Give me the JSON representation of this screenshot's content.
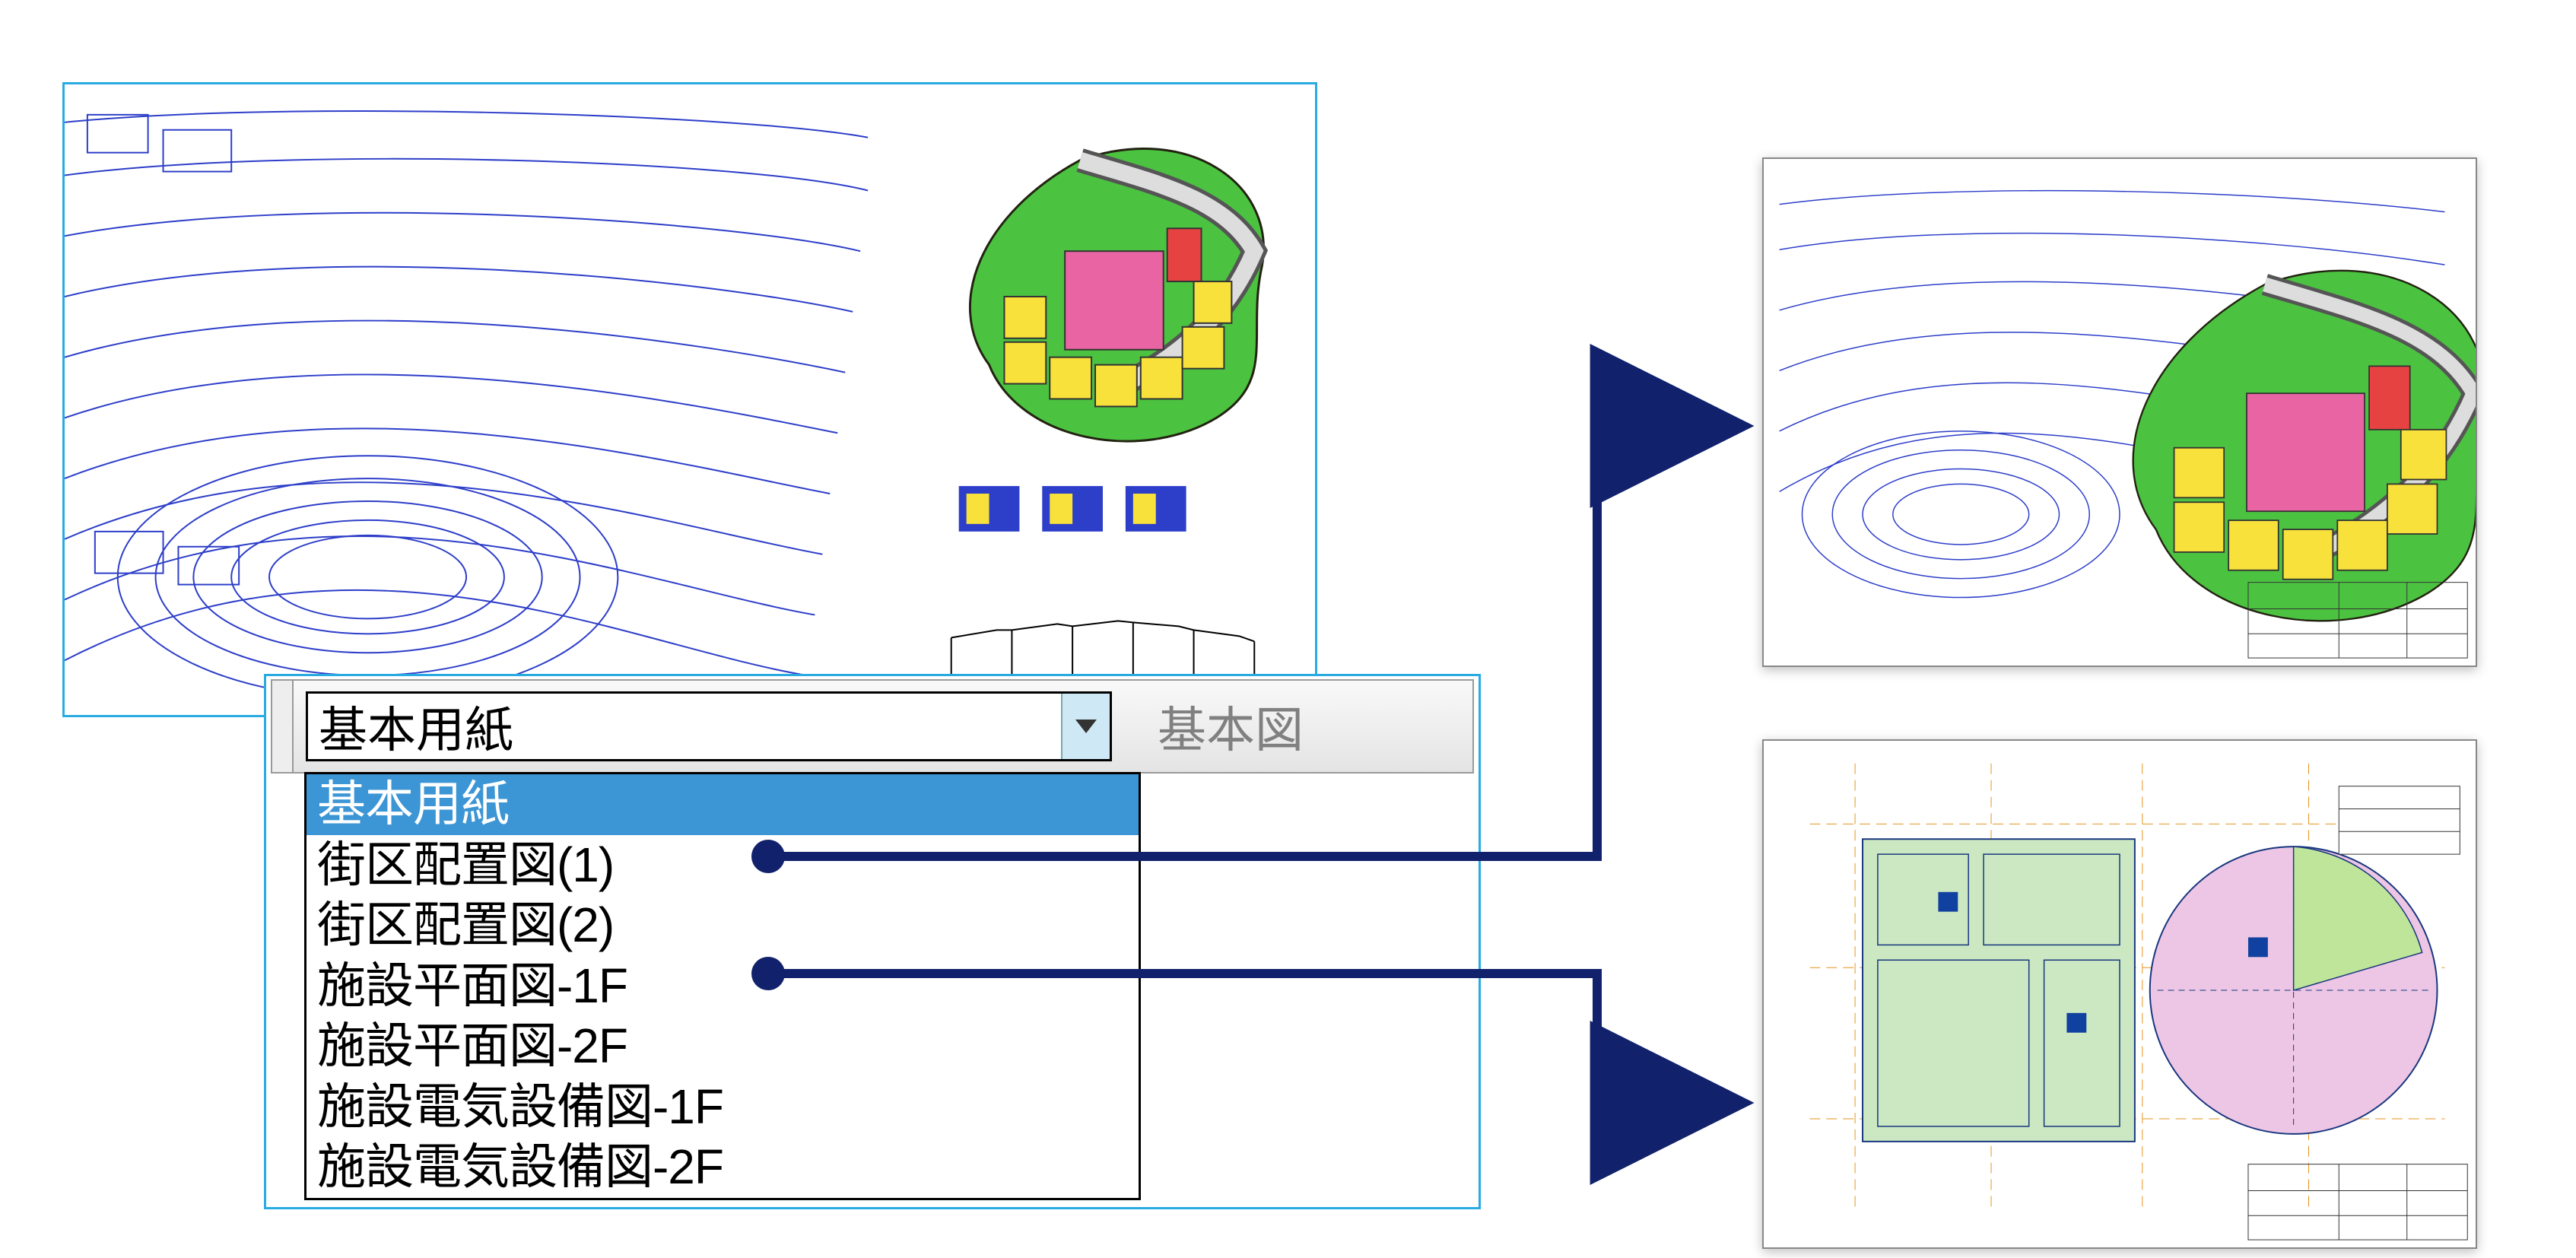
{
  "select": {
    "current": "基本用紙",
    "options": [
      "基本用紙",
      "街区配置図(1)",
      "街区配置図(2)",
      "施設平面図-1F",
      "施設平面図-2F",
      "施設電気設備図-1F",
      "施設電気設備図-2F"
    ]
  },
  "toolbar": {
    "right_label": "基本図"
  },
  "connector_targets": {
    "option_index_to_thumb1": 1,
    "option_index_to_thumb2": 3
  }
}
